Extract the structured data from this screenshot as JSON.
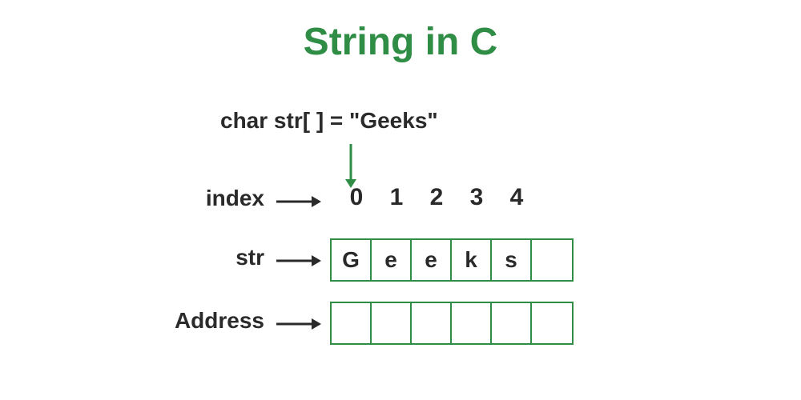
{
  "title": "String in C",
  "declaration": "char str[ ] = \"Geeks\"",
  "labels": {
    "index": "index",
    "str": "str",
    "address": "Address"
  },
  "indexes": [
    "0",
    "1",
    "2",
    "3",
    "4"
  ],
  "str_cells": [
    "G",
    "e",
    "e",
    "k",
    "s",
    ""
  ],
  "address_cells": [
    "",
    "",
    "",
    "",
    "",
    ""
  ],
  "colors": {
    "accent": "#2f8d46",
    "text": "#2a2a2a"
  }
}
